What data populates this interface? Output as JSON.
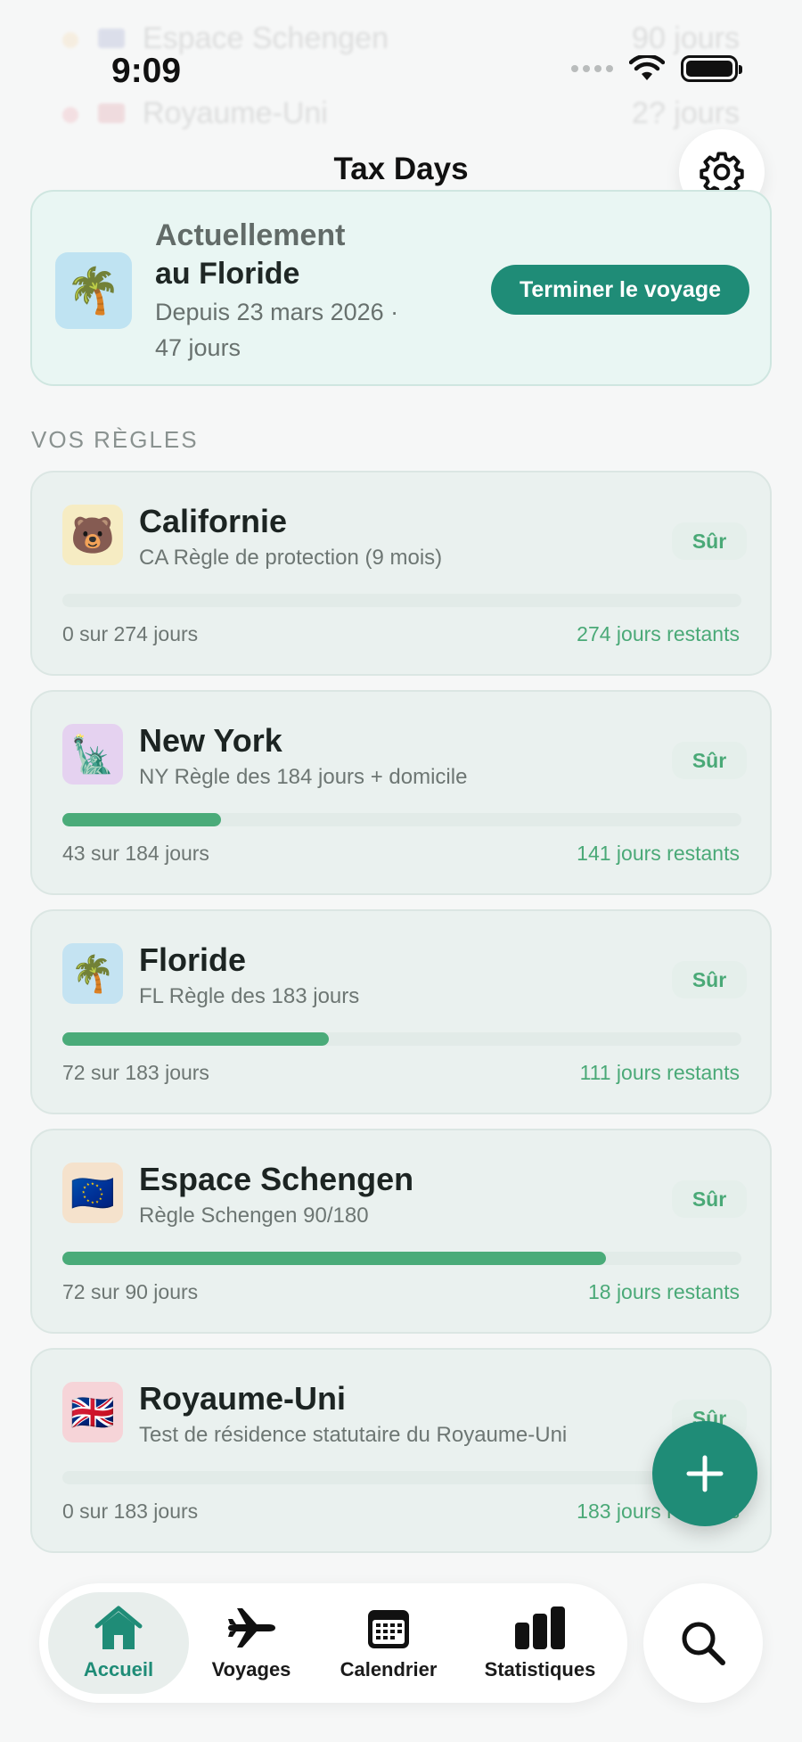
{
  "ghost_rows": [
    {
      "name": "Espace Schengen",
      "value": "90 jours",
      "dot_color": "#f3b24a",
      "flag_color": "#2f3f9a"
    },
    {
      "name": "Royaume-Uni",
      "value": "2? jours",
      "dot_color": "#e4455a",
      "flag_color": "#c8283c"
    }
  ],
  "status_bar": {
    "time": "9:09"
  },
  "header": {
    "title": "Tax Days"
  },
  "current_trip": {
    "icon": "🌴",
    "kicker": "Actuellement",
    "place": "au Floride",
    "since": "Depuis 23 mars 2026 ·",
    "duration": "47 jours",
    "end_button": "Terminer le voyage"
  },
  "rules_section": {
    "title": "VOS RÈGLES"
  },
  "rules": [
    {
      "icon": "🐻",
      "icon_bg": "#f6ecc3",
      "name": "Californie",
      "desc": "CA Règle de protection (9 mois)",
      "badge": "Sûr",
      "used": 0,
      "limit": 274,
      "used_text": "0 sur 274 jours",
      "remaining_text": "274 jours restants",
      "progress": 0.0
    },
    {
      "icon": "🗽",
      "icon_bg": "#e5d2f0",
      "name": "New York",
      "desc": "NY Règle des 184 jours + domicile",
      "badge": "Sûr",
      "used": 43,
      "limit": 184,
      "used_text": "43 sur 184 jours",
      "remaining_text": "141 jours restants",
      "progress": 0.234
    },
    {
      "icon": "🌴",
      "icon_bg": "#c4e3f2",
      "name": "Floride",
      "desc": "FL Règle des 183 jours",
      "badge": "Sûr",
      "used": 72,
      "limit": 183,
      "used_text": "72 sur 183 jours",
      "remaining_text": "111 jours restants",
      "progress": 0.393
    },
    {
      "icon": "🇪🇺",
      "icon_bg": "#f5e2cc",
      "name": "Espace Schengen",
      "desc": "Règle Schengen 90/180",
      "badge": "Sûr",
      "used": 72,
      "limit": 90,
      "used_text": "72 sur 90 jours",
      "remaining_text": "18 jours restants",
      "progress": 0.8
    },
    {
      "icon": "🇬🇧",
      "icon_bg": "#f6d4d8",
      "name": "Royaume-Uni",
      "desc": "Test de résidence statutaire du Royaume-Uni",
      "badge": "Sûr",
      "used": 0,
      "limit": 183,
      "used_text": "0 sur 183 jours",
      "remaining_text": "183 jours restants",
      "progress": 0.0
    }
  ],
  "tabs": [
    {
      "label": "Accueil",
      "icon": "home-icon",
      "active": true
    },
    {
      "label": "Voyages",
      "icon": "airplane-icon",
      "active": false
    },
    {
      "label": "Calendrier",
      "icon": "calendar-icon",
      "active": false
    },
    {
      "label": "Statistiques",
      "icon": "bar-chart-icon",
      "active": false
    }
  ],
  "colors": {
    "accent": "#1f8c77",
    "progress": "#4aab79",
    "safe": "#4aa977"
  }
}
